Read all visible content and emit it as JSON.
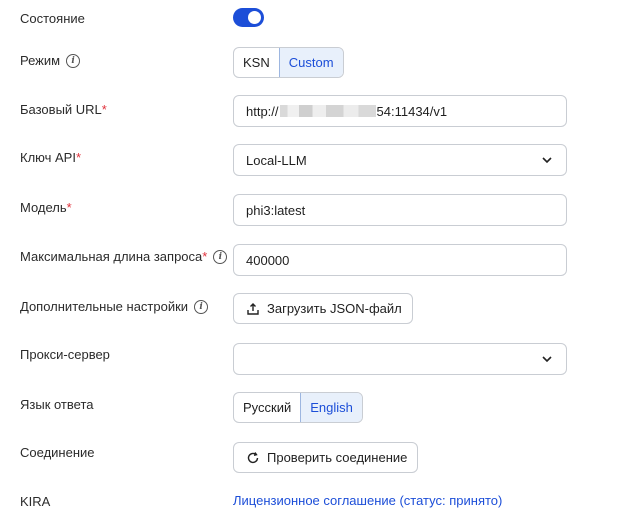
{
  "rows": {
    "state": {
      "label": "Состояние",
      "enabled": true
    },
    "mode": {
      "label": "Режим",
      "options": [
        "KSN",
        "Custom"
      ],
      "selected": "Custom"
    },
    "base_url": {
      "label": "Базовый URL",
      "value_prefix": "http://",
      "value_suffix": "54:11434/v1"
    },
    "api_key": {
      "label": "Ключ API",
      "value": "Local-LLM"
    },
    "model": {
      "label": "Модель",
      "value": "phi3:latest"
    },
    "max_request": {
      "label": "Максимальная длина запроса",
      "value": "400000"
    },
    "extra": {
      "label": "Дополнительные настройки",
      "button": "Загрузить JSON-файл"
    },
    "proxy": {
      "label": "Прокси-сервер",
      "value": ""
    },
    "response_lang": {
      "label": "Язык ответа",
      "options": [
        "Русский",
        "English"
      ],
      "selected": "English"
    },
    "connection": {
      "label": "Соединение",
      "button": "Проверить соединение"
    },
    "kira": {
      "label": "KIRA",
      "link": "Лицензионное соглашение (статус: принято)"
    }
  },
  "required_mark": "*",
  "info_glyph": "i",
  "colors": {
    "accent": "#1c4ed8",
    "required": "#e0303a"
  },
  "icons": [
    "info-icon",
    "chevron-down-icon",
    "upload-icon",
    "refresh-icon"
  ]
}
